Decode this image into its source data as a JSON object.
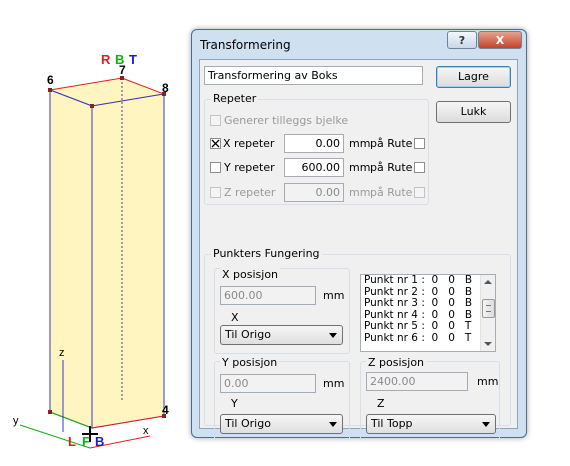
{
  "scene": {
    "top_labels": {
      "r": "R",
      "b": "B",
      "t": "T"
    },
    "corner_labels": {
      "c6": "6",
      "c7": "7",
      "c8": "8",
      "c4": "4"
    },
    "axis_labels": {
      "z": "z",
      "y": "y",
      "x": "x"
    },
    "bottom_labels": {
      "l": "L",
      "f": "F",
      "b": "B"
    },
    "colors": {
      "face": "#fff5c0",
      "edge": "#3a3ac8",
      "red": "#e02020",
      "green": "#10b010",
      "blue": "#1c1ccc"
    }
  },
  "dialog": {
    "title": "Transformering",
    "help_glyph": "?",
    "close_glyph": "X",
    "name_field": "Transformering av Boks",
    "save_label": "Lagre",
    "close_label": "Lukk",
    "repeat": {
      "title": "Repeter",
      "extra_beam_label": "Generer tilleggs bjelke",
      "x_label": "X repeter",
      "x_value": "0.00",
      "x_checked": true,
      "y_label": "Y repeter",
      "y_value": "600.00",
      "y_checked": false,
      "z_label": "Z repeter",
      "z_value": "0.00",
      "unit": "mm",
      "route_label": "på Rute"
    },
    "points": {
      "title": "Punkters Fungering",
      "x_pos_label": "X posisjon",
      "x_pos_value": "600.00",
      "x_axis_label": "X",
      "x_select": "Til Origo",
      "list_items": [
        "Punkt nr 1 :  0   0   B",
        "Punkt nr 2 :  0   0   B",
        "Punkt nr 3 :  0   0   B",
        "Punkt nr 4 :  0   0   B",
        "Punkt nr 5 :  0   0   T",
        "Punkt nr 6 :  0   0   T"
      ],
      "y_pos_label": "Y posisjon",
      "y_pos_value": "0.00",
      "y_axis_label": "Y",
      "y_select": "Til Origo",
      "z_pos_label": "Z posisjon",
      "z_pos_value": "2400.00",
      "z_axis_label": "Z",
      "z_select": "Til Topp",
      "unit": "mm"
    }
  }
}
